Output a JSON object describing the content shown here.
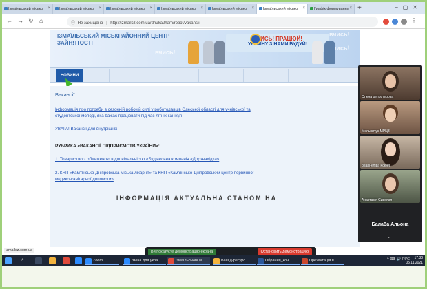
{
  "colors": {
    "accent": "#1f5aa8",
    "link": "#2556b6",
    "frame_border": "#9fd07a",
    "stop": "#d93a2e",
    "taskbar": "#1d2636"
  },
  "tabs": [
    {
      "label": "Ізмаїльський місько",
      "icon": "globe-icon"
    },
    {
      "label": "Ізмаїльський місько",
      "icon": "globe-icon"
    },
    {
      "label": "Ізмаїльський місько",
      "icon": "globe-icon"
    },
    {
      "label": "Ізмаїльський місько",
      "icon": "globe-icon"
    },
    {
      "label": "Ізмаїльський місько",
      "icon": "globe-icon"
    },
    {
      "label": "Ізмаїльський місько",
      "icon": "globe-icon"
    },
    {
      "label": "Графік формування",
      "icon": "globe-icon"
    }
  ],
  "toolbar": {
    "security_label": "Не захищено",
    "url": "http://izmailcz.com.ua/dhuka2ham/robot/vakansii",
    "back_icon": "arrow-left-icon",
    "forward_icon": "arrow-right-icon",
    "reload_icon": "reload-icon",
    "home_icon": "home-icon"
  },
  "site": {
    "title": "ІЗМАЇЛЬСЬКИЙ МІСЬКРАЙОННИЙ ЦЕНТР ЗАЙНЯТОСТІ",
    "slogan_top": "ВЧИСЬ! ПРАЦЮЙ!",
    "slogan_bottom": "УКРАЇНУ З НАМИ БУДУЙ!",
    "ghost_words": [
      "вчись!",
      "вчись!",
      "вчись!"
    ],
    "nav_news": "НОВИНИ"
  },
  "content": {
    "heading": "Вакансії",
    "info_link": "Інформація про потреби в сезонній робочій силі у роботодавців Одеської області для учнівської та студентської молоді, яка бажає працювати під час літніх канікул",
    "attention_link": "УВАГА! Вакансії для внутрішніх",
    "rubric": "РУБРИКА «ВАКАНСІЇ ПІДПРИЄМСТВ УКРАЇНИ»:",
    "item1": "1. Товариство з обмеженою відповідальністю «Будівельна компанія «Дорзнахідка»",
    "item2": "2. КНП «Кам'янсько-Дніпровська міська лікарня» та КНП «Кам'янсько-Дніпровський центр первинної медико-санітарної допомоги»",
    "info_heading": "ІНФОРМАЦІЯ АКТУАЛЬНА СТАНОМ НА"
  },
  "share": {
    "message": "Ви показуєте демонстрацію екрана",
    "stop_label": "Остановить демонстрацию"
  },
  "status_url": "izmailcz.com.ua",
  "video": {
    "participants": [
      {
        "name": "Олена репортерова"
      },
      {
        "name": "Мельничук МРЦЗ"
      },
      {
        "name": "Зварнеліва Ксеня"
      },
      {
        "name": "Анастасія Сиволап"
      }
    ],
    "speaker": "Балаба Альона"
  },
  "taskbar": {
    "items": [
      {
        "label": "Zoom",
        "icon": "zoom-icon"
      },
      {
        "label": "Зміна для укра...",
        "icon": "zoom-icon"
      },
      {
        "label": "Ізмаїльський м...",
        "icon": "chrome-icon"
      },
      {
        "label": "Ваш д-ресурс",
        "icon": "folder-icon"
      },
      {
        "label": "Обрання_кон...",
        "icon": "word-icon"
      },
      {
        "label": "Презентація в...",
        "icon": "powerpoint-icon"
      }
    ],
    "tray": "^ ⌨ 🔊 РУС",
    "time": "17:30",
    "date": "05.11.2021"
  }
}
